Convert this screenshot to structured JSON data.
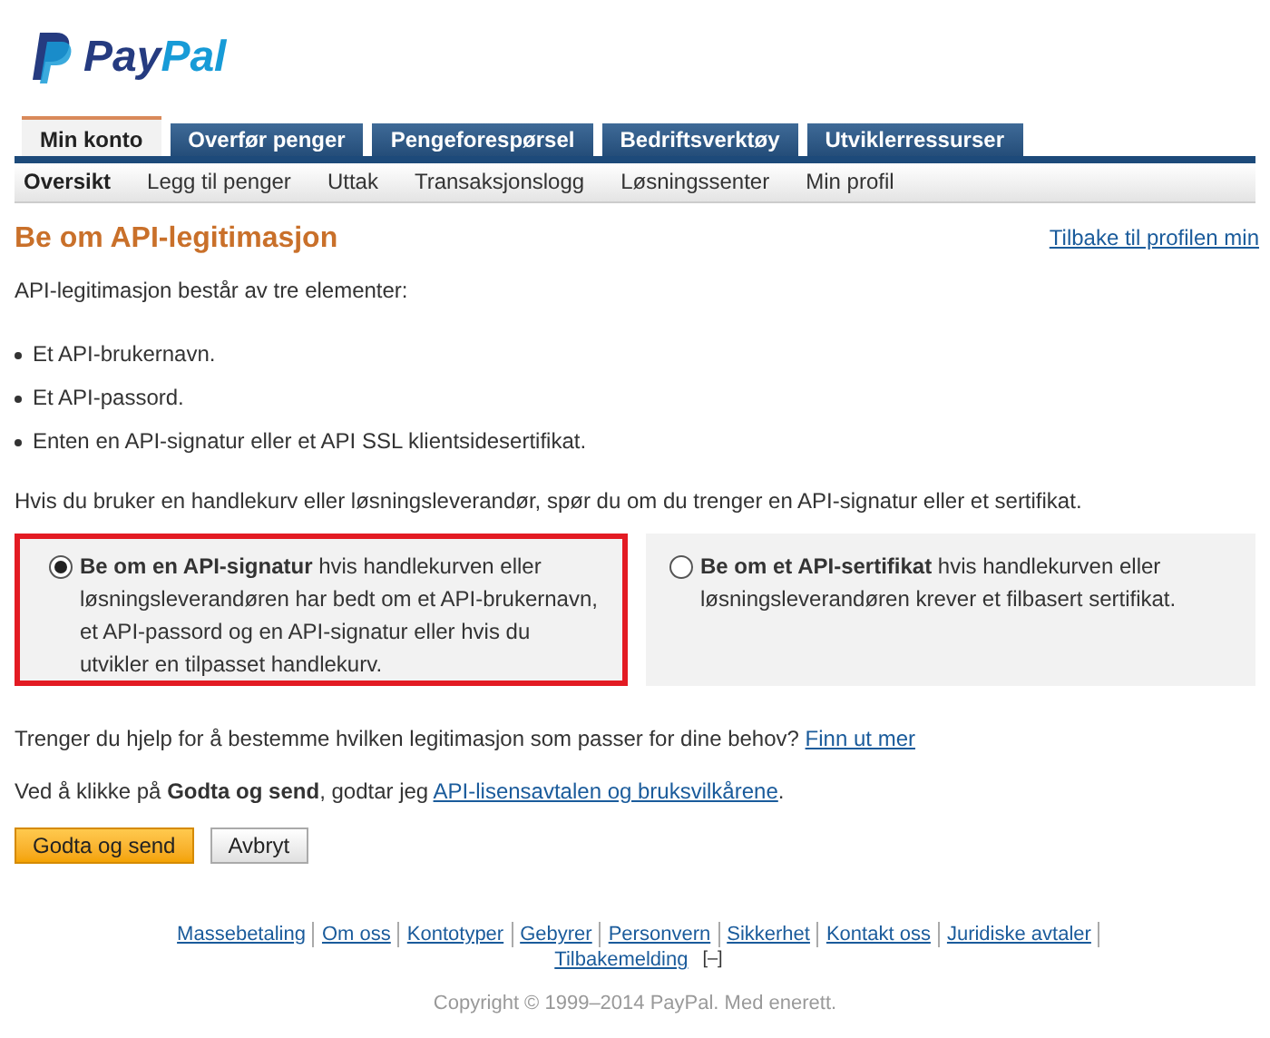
{
  "logo": {
    "part_1": "Pay",
    "part_2": "Pal"
  },
  "tabs": [
    {
      "label": "Min konto",
      "selected": true
    },
    {
      "label": "Overfør penger",
      "selected": false
    },
    {
      "label": "Pengeforespørsel",
      "selected": false
    },
    {
      "label": "Bedriftsverktøy",
      "selected": false
    },
    {
      "label": "Utviklerressurser",
      "selected": false
    }
  ],
  "subnav": [
    {
      "label": "Oversikt",
      "selected": true
    },
    {
      "label": "Legg til penger",
      "selected": false
    },
    {
      "label": "Uttak",
      "selected": false
    },
    {
      "label": "Transaksjonslogg",
      "selected": false
    },
    {
      "label": "Løsningssenter",
      "selected": false
    },
    {
      "label": "Min profil",
      "selected": false
    }
  ],
  "heading": "Be om API-legitimasjon",
  "back_link": "Tilbake til profilen min",
  "intro": "API-legitimasjon består av tre elementer:",
  "bullets": [
    "Et API-brukernavn.",
    "Et API-passord.",
    "Enten en API-signatur eller et API SSL klientsidesertifikat."
  ],
  "question": "Hvis du bruker en handlekurv eller løsningsleverandør, spør du om du trenger en API-signatur eller et sertifikat.",
  "options": [
    {
      "text": "**Be om en API-signatur** hvis handlekurven eller løsningsleverandøren har bedt om et API-brukernavn, et API-passord og en API-signatur eller hvis du utvikler en tilpasset handlekurv.",
      "selected": true
    },
    {
      "text": "**Be om et API-sertifikat** hvis handlekurven eller løsningsleverandøren krever et filbasert sertifikat.",
      "selected": false
    }
  ],
  "help": {
    "text": "Trenger du hjelp for å bestemme hvilken legitimasjon som passer for dine behov?",
    "link": "Finn ut mer"
  },
  "agreement": {
    "text": "Ved å klikke på **Godta og send**, godtar jeg",
    "link": "API-lisensavtalen og bruksvilkårene",
    "suffix": "."
  },
  "buttons": [
    {
      "label": "Godta og send",
      "kind": "primary"
    },
    {
      "label": "Avbryt",
      "kind": "secondary"
    }
  ],
  "footer_links": [
    "Massebetaling",
    "Om oss",
    "Kontotyper",
    "Gebyrer",
    "Personvern",
    "Sikkerhet",
    "Kontakt oss",
    "Juridiske avtaler",
    "Tilbakemelding"
  ],
  "footer_toggle": "[–]",
  "copyright": "Copyright © 1999–2014 PayPal. Med enerett."
}
